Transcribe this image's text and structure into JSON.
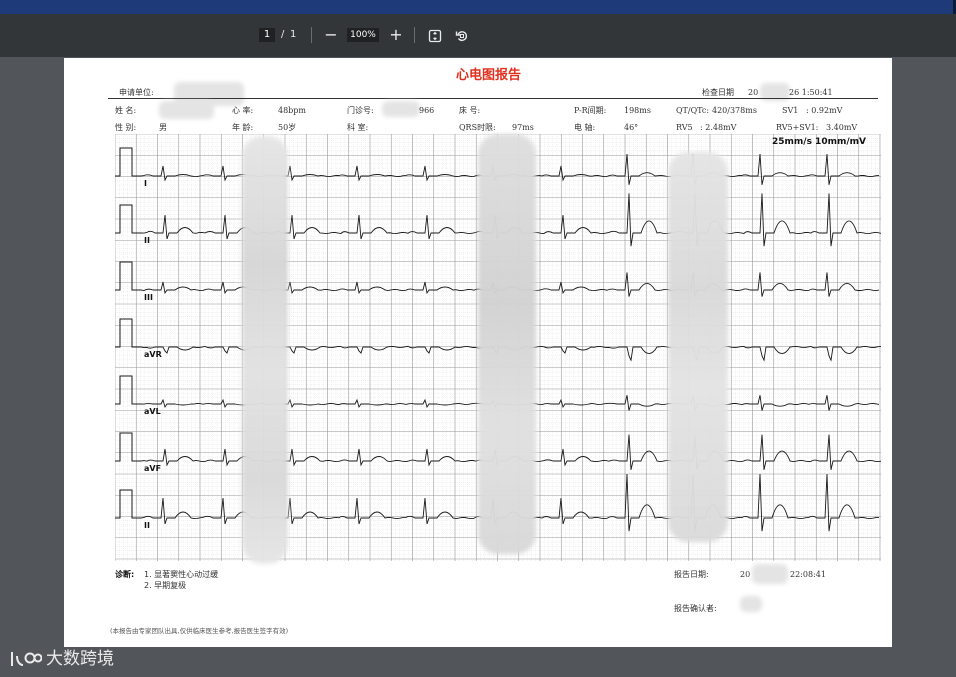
{
  "viewer": {
    "current_page": "1",
    "page_separator": "/",
    "total_pages": "1",
    "zoom_level": "100%",
    "zoom_out_symbol": "−",
    "zoom_in_symbol": "+"
  },
  "report": {
    "title": "心电图报告",
    "labels": {
      "unit": "申请单位:",
      "exam_date": "检查日期",
      "name": "姓  名:",
      "sex": "性  别:",
      "heart_rate": "心  率:",
      "age": "年  龄:",
      "clinic_no": "门诊号:",
      "dept": "科  室:",
      "bed": "床  号:",
      "qrs": "QRS时限:",
      "pr": "P-R间期:",
      "axis": "电  轴:",
      "qt": "QT/QTc:",
      "rv5": "RV5",
      "sv1": "SV1",
      "rv5sv1": "RV5+SV1:"
    },
    "values": {
      "exam_date_visible_start": "20",
      "exam_date_visible_end": "26 1:50:41",
      "sex": "男",
      "heart_rate": "48bpm",
      "age": "50岁",
      "clinic_no_visible": "966",
      "qrs": "97ms",
      "pr": "198ms",
      "axis": "46°",
      "qt": "420/378ms",
      "rv5": ":  2.48mV",
      "sv1": ":  0.92mV",
      "rv5sv1": "3.40mV"
    },
    "speed_label": "25mm/s 10mm/mV",
    "lead_labels": [
      "I",
      "II",
      "III",
      "aVR",
      "aVL",
      "aVF",
      "II"
    ],
    "diagnosis": {
      "label": "诊断:",
      "items": [
        "1. 显著窦性心动过缓",
        "2. 早期复极"
      ]
    },
    "report_date_label": "报告日期:",
    "report_date_visible_start": "20",
    "report_date_visible_end": "22:08:41",
    "confirm_label": "报告确认者:",
    "footer_note": "(本报告由专家团队出具,仅供临床医生参考,报告医生签字有效)"
  },
  "watermark": {
    "text": "大数跨境"
  },
  "colors": {
    "title_red": "#e0301e",
    "grid_line": "#9a9a9a",
    "trace": "#1a1a1a",
    "toolbar": "#323639",
    "top_strip": "#1f3a78"
  }
}
